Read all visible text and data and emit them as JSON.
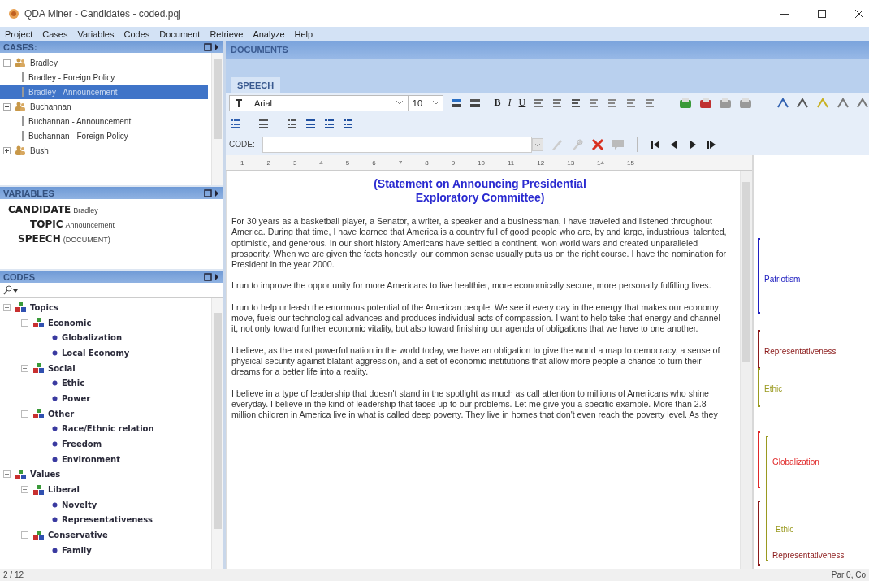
{
  "window": {
    "title": "QDA Miner - Candidates - coded.pqj"
  },
  "menu": [
    "Project",
    "Cases",
    "Variables",
    "Codes",
    "Document",
    "Retrieve",
    "Analyze",
    "Help"
  ],
  "cases": {
    "title": "CASES:",
    "tree": [
      {
        "label": "Bradley",
        "expanded": true,
        "selected": false,
        "children": [
          {
            "label": "Bradley - Foreign Policy",
            "selected": false
          },
          {
            "label": "Bradley - Announcement",
            "selected": true
          }
        ]
      },
      {
        "label": "Buchannan",
        "expanded": true,
        "selected": false,
        "children": [
          {
            "label": "Buchannan - Announcement",
            "selected": false
          },
          {
            "label": "Buchannan - Foreign Policy",
            "selected": false
          }
        ]
      },
      {
        "label": "Bush",
        "expanded": false,
        "selected": false
      }
    ]
  },
  "variables": {
    "title": "VARIABLES",
    "rows": [
      {
        "name": "CANDIDATE",
        "value": "Bradley"
      },
      {
        "name": "TOPIC",
        "value": "Announcement"
      },
      {
        "name": "SPEECH",
        "value": "(DOCUMENT)"
      }
    ]
  },
  "codes": {
    "title": "CODES",
    "tree": [
      {
        "kind": "category",
        "label": "Topics",
        "expanded": true,
        "children": [
          {
            "kind": "category",
            "label": "Economic",
            "expanded": true,
            "children": [
              {
                "kind": "code",
                "label": "Globalization"
              },
              {
                "kind": "code",
                "label": "Local Economy"
              }
            ]
          },
          {
            "kind": "category",
            "label": "Social",
            "expanded": true,
            "children": [
              {
                "kind": "code",
                "label": "Ethic"
              },
              {
                "kind": "code",
                "label": "Power"
              }
            ]
          },
          {
            "kind": "category",
            "label": "Other",
            "expanded": true,
            "children": [
              {
                "kind": "code",
                "label": "Race/Ethnic relation"
              },
              {
                "kind": "code",
                "label": "Freedom"
              },
              {
                "kind": "code",
                "label": "Environment"
              }
            ]
          }
        ]
      },
      {
        "kind": "category",
        "label": "Values",
        "expanded": true,
        "children": [
          {
            "kind": "category",
            "label": "Liberal",
            "expanded": true,
            "children": [
              {
                "kind": "code",
                "label": "Novelty"
              },
              {
                "kind": "code",
                "label": "Representativeness"
              }
            ]
          },
          {
            "kind": "category",
            "label": "Conservative",
            "expanded": true,
            "children": [
              {
                "kind": "code",
                "label": "Family"
              }
            ]
          }
        ]
      }
    ]
  },
  "documents": {
    "title": "DOCUMENTS",
    "tabs": [
      {
        "label": "SPEECH",
        "selected": true
      }
    ],
    "font": {
      "value": "Arial"
    },
    "size": {
      "value": "10"
    },
    "format_buttons": [
      {
        "kind": "bold",
        "label": "B"
      },
      {
        "kind": "italic",
        "label": "I"
      },
      {
        "kind": "underline",
        "label": "U"
      }
    ],
    "code_label": "CODE:",
    "ruler": [
      "1",
      "2",
      "3",
      "4",
      "5",
      "6",
      "7",
      "8",
      "9",
      "10",
      "11",
      "12",
      "13",
      "14",
      "15"
    ],
    "heading": [
      "(Statement on Announcing Presidential",
      "Exploratory Committee)"
    ],
    "paragraphs": [
      "For 30 years as a basketball player, a Senator, a writer, a speaker and a businessman, I have traveled and listened throughout America. During that time, I have learned that America is a country full of good people who are, by and large, industrious, talented, optimistic, and generous. In our short history Americans have settled a continent, won world wars and created unparalleled prosperity. When we are given the facts honestly, our common sense usually puts us on the right course. I have the nomination for President in the year 2000.",
      "I run to improve the opportunity for more Americans to live healthier, more economically secure, more personally fulfilling lives.",
      "I run to help unleash the enormous potential of the American people. We see it every day in the energy that makes our economy move, fuels our technological advances and produces individual acts of compassion. I want to help take that energy and channel it, not only toward further economic vitality, but also toward finishing our agenda of obligations that we have to one another.",
      "I believe, as the most powerful nation in the world today, we have an obligation to give the world a map to democracy, a sense of physical security against blatant aggression, and a set of economic institutions that allow more people a chance to turn their dreams for a better life into a reality.",
      "I believe in a type of leadership that doesn't stand in the spotlight as much as call attention to millions of Americans who shine everyday. I believe in the kind of leadership that faces up to our problems. Let me give you a specific example. More than 2.8 million children in America live in what is called deep poverty. They live in homes that don't even reach the poverty level. As they"
    ],
    "margin_codes": [
      {
        "label": "Patriotism",
        "color": "#2020c0"
      },
      {
        "label": "Representativeness",
        "color": "#8b1a1a"
      },
      {
        "label": "Ethic",
        "color": "#9a9a20"
      },
      {
        "label": "Globalization",
        "color": "#e02828"
      },
      {
        "label": "Ethic",
        "color": "#9a9a20"
      },
      {
        "label": "Representativeness",
        "color": "#8b1a1a"
      }
    ]
  },
  "status_bar": {
    "left": "2 / 12",
    "right": "Par 0, Co"
  }
}
